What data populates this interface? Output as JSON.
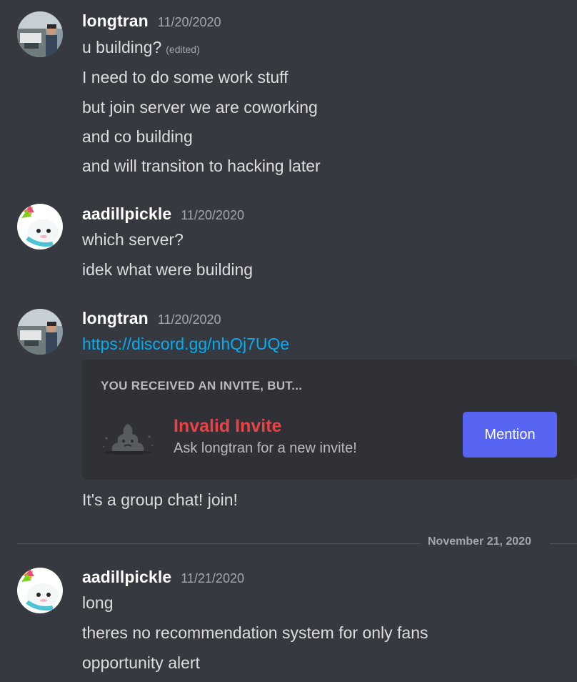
{
  "messages": [
    {
      "username": "longtran",
      "timestamp": "11/20/2020",
      "avatar": "photo-avatar",
      "lines": [
        "u building?",
        "I need to do some work stuff",
        "but join server we are coworking",
        "and co building",
        "and will transiton to hacking later"
      ],
      "edited_label": "(edited)"
    },
    {
      "username": "aadillpickle",
      "timestamp": "11/20/2020",
      "avatar": "unicorn-avatar",
      "lines": [
        "which server?",
        "idek what were building"
      ]
    },
    {
      "username": "longtran",
      "timestamp": "11/20/2020",
      "avatar": "photo-avatar",
      "link": "https://discord.gg/nhQj7UQe",
      "after_embed": "It's a group chat! join!"
    },
    {
      "username": "aadillpickle",
      "timestamp": "11/21/2020",
      "avatar": "unicorn-avatar",
      "lines": [
        "long",
        "theres no recommendation system for only fans",
        "opportunity alert"
      ]
    }
  ],
  "invite_embed": {
    "header": "YOU RECEIVED AN INVITE, BUT...",
    "title": "Invalid Invite",
    "subtitle": "Ask longtran for a new invite!",
    "button_label": "Mention",
    "icon": "poop-icon"
  },
  "date_divider": "November 21, 2020",
  "colors": {
    "background": "#36393f",
    "embed_background": "#2f3136",
    "link": "#00aff4",
    "invalid": "#ed4245",
    "button": "#5865f2"
  }
}
